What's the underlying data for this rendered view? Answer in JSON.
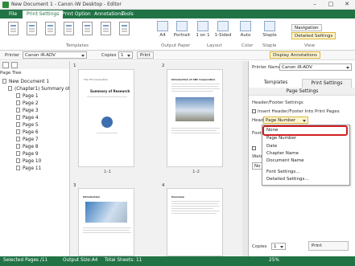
{
  "window": {
    "title": "New Document 1 - Canon iW Desktop - Editor"
  },
  "ribbon": {
    "tabs": [
      "File",
      "Print Settings",
      "Print Option",
      "Annotations",
      "Tools"
    ],
    "templates_label": "Templates",
    "output_paper_label": "Output Paper",
    "layout_label": "Layout",
    "color_label": "Color",
    "staple_group_label": "Staple",
    "view_label": "View",
    "paper_size": "A4",
    "orientation": "Portrait",
    "pages_per_sheet": "1\non 1",
    "sides": "1-Sided",
    "color_mode": "Auto",
    "staple_btn": "Staple",
    "navigation": "Navigation",
    "detailed_settings": "Detailed Settings"
  },
  "toolbar": {
    "printer_label": "Printer",
    "printer_value": "Canon iR-ADV",
    "copies_label": "Copies",
    "copies_value": "1",
    "print": "Print",
    "display_annotations": "Display Annotations"
  },
  "tree": {
    "title": "Page Tree",
    "root": "New Document 1",
    "chapter": "(Chapter1) Summary of R",
    "pages": [
      "Page 1",
      "Page 2",
      "Page 3",
      "Page 4",
      "Page 5",
      "Page 6",
      "Page 7",
      "Page 8",
      "Page 9",
      "Page 10",
      "Page 11"
    ]
  },
  "canvas": {
    "page_numbers": [
      "1",
      "2",
      "3",
      "4"
    ],
    "page_labels": [
      "1-1",
      "1-2"
    ],
    "page1_title": "Summary of Research",
    "page1_header": "The 7th Corporation",
    "page2_title": "Introduction of ABC Corporation",
    "page3_title": "Introduction",
    "page4_title": "Overview"
  },
  "panel": {
    "printer_name_label": "Printer Name",
    "printer_name_value": "Canon iR-ADV",
    "tab_templates": "Templates",
    "tab_print_settings": "Print Settings",
    "section": "Page Settings",
    "header_footer": "Header/Footer Settings",
    "insert_label": "Insert Header/Footer Into Print Pages",
    "header_label": "Header",
    "header_value": "Page Number",
    "footer_label": "Foote",
    "water_label": "Waterm",
    "water_value": "No W",
    "copies_label": "Copies",
    "copies_value": "1",
    "print_btn": "Print"
  },
  "dropdown": {
    "options": [
      "None",
      "Page Number",
      "Date",
      "Chapter Name",
      "Document Name",
      "Font Settings...",
      "Detailed Settings..."
    ]
  },
  "status": {
    "selected": "Selected Pages /11",
    "output_size": "Output Size:A4",
    "total": "Total Sheets: 11",
    "zoom": "25%"
  }
}
